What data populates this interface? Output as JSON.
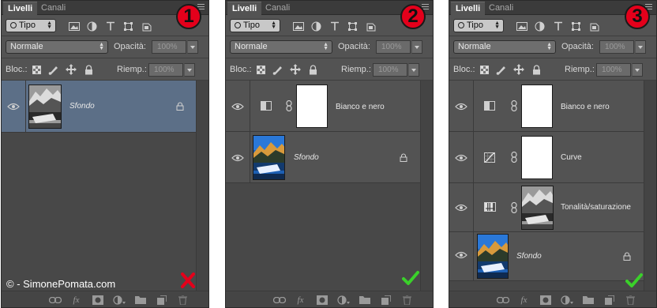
{
  "tabs": {
    "layers": "Livelli",
    "channels": "Canali"
  },
  "filter": {
    "label": "Tipo"
  },
  "blend": {
    "mode": "Normale",
    "opacity_label": "Opacità:",
    "opacity_value": "100%"
  },
  "lock": {
    "label": "Bloc.:",
    "fill_label": "Riemp.:",
    "fill_value": "100%"
  },
  "footer_icons": [
    "link-icon",
    "fx-icon",
    "mask-icon",
    "adjustment-icon",
    "folder-icon",
    "new-layer-icon",
    "trash-icon"
  ],
  "fx_label": "fx",
  "panels": [
    {
      "badge": "1",
      "layers": [
        {
          "name": "Sfondo",
          "kind": "background",
          "thumbnail": "bw-landscape",
          "locked": true,
          "selected": true
        }
      ],
      "watermark": "© - SimonePomata.com",
      "result": {
        "symbol": "✗",
        "meaning": "wrong",
        "color": "#e4001b"
      }
    },
    {
      "badge": "2",
      "layers": [
        {
          "name": "Bianco e nero",
          "kind": "adjustment",
          "adjustment_icon": "black-white-icon"
        },
        {
          "name": "Sfondo",
          "kind": "background",
          "thumbnail": "color-landscape",
          "locked": true
        }
      ],
      "result": {
        "symbol": "✓",
        "meaning": "correct",
        "color": "#3ad12a"
      }
    },
    {
      "badge": "3",
      "layers": [
        {
          "name": "Bianco e nero",
          "kind": "adjustment",
          "adjustment_icon": "black-white-icon"
        },
        {
          "name": "Curve",
          "kind": "adjustment",
          "adjustment_icon": "curves-icon"
        },
        {
          "name": "Tonalità/saturazione",
          "kind": "layer",
          "thumbnail": "bw-landscape",
          "adjustment_icon": "hue-saturation-icon"
        },
        {
          "name": "Sfondo",
          "kind": "background",
          "thumbnail": "color-landscape",
          "locked": true
        }
      ],
      "result": {
        "symbol": "✓",
        "meaning": "correct",
        "color": "#3ad12a"
      }
    }
  ]
}
